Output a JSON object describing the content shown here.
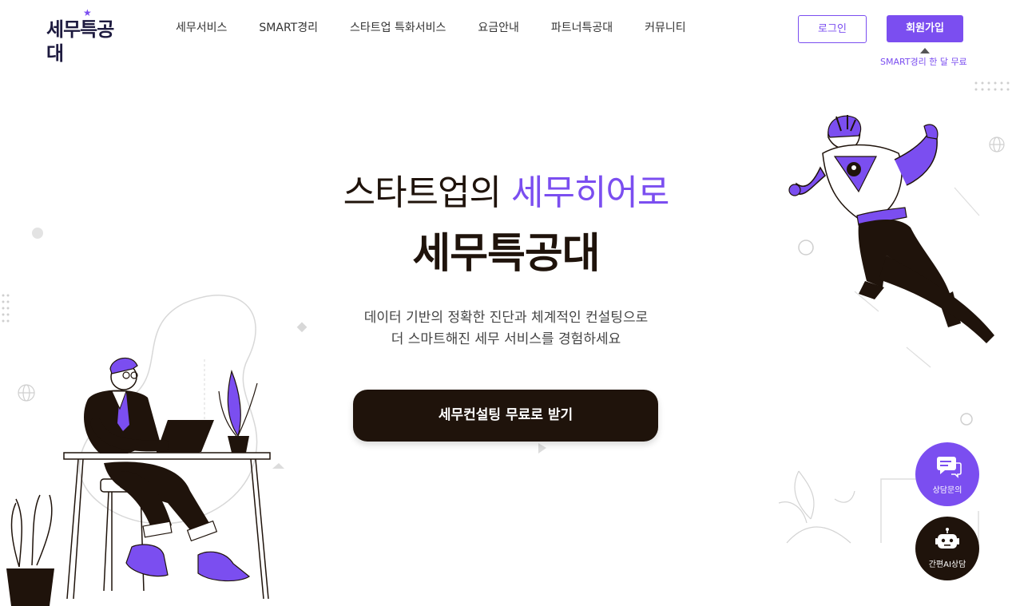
{
  "header": {
    "logo_text": "세무특공대",
    "nav": [
      {
        "label": "세무서비스"
      },
      {
        "label": "SMART경리"
      },
      {
        "label": "스타트업 특화서비스"
      },
      {
        "label": "요금안내"
      },
      {
        "label": "파트너특공대"
      },
      {
        "label": "커뮤니티"
      }
    ],
    "login_label": "로그인",
    "join_label": "회원가입",
    "join_promo": "SMART경리 한 달 무료"
  },
  "hero": {
    "line1_prefix": "스타트업의 ",
    "line1_accent": "세무히어로",
    "line2": "세무특공대",
    "desc_line1": "데이터 기반의 정확한 진단과 체계적인 컨설팅으로",
    "desc_line2": "더 스마트해진 세무 서비스를 경험하세요",
    "cta_label": "세무컨설팅 무료로 받기"
  },
  "floating": {
    "consult_label": "상담문의",
    "ai_label": "간편AI상담"
  },
  "colors": {
    "accent": "#7b4ef0",
    "dark": "#1f130b"
  },
  "icons": {
    "consult": "chat-bubbles-icon",
    "ai": "robot-icon"
  }
}
